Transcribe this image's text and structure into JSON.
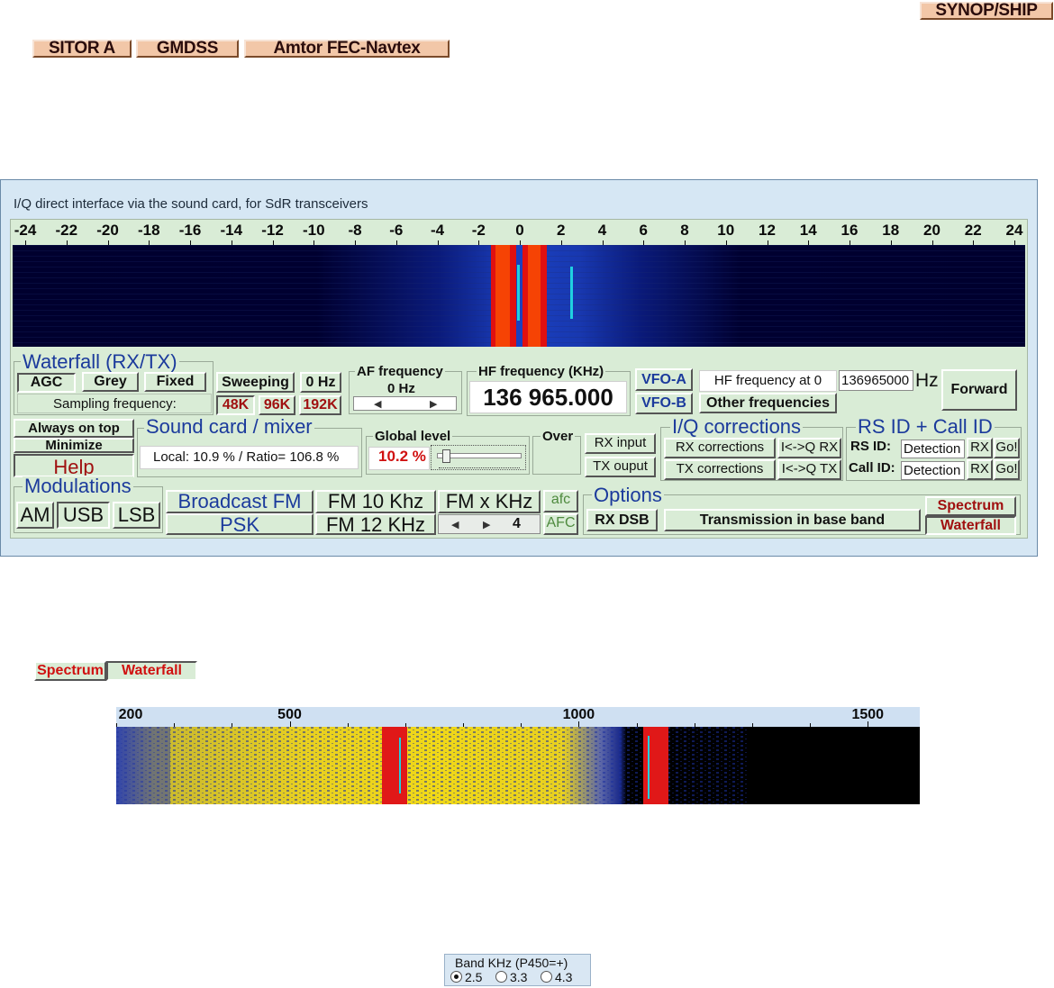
{
  "top_buttons": {
    "synop_ship": "SYNOP/SHIP",
    "sitor_a": "SITOR A",
    "gmdss": "GMDSS",
    "amtor": "Amtor FEC-Navtex"
  },
  "window": {
    "title": "I/Q direct interface via the sound card, for SdR transceivers",
    "scale_ticks": [
      "-24",
      "-22",
      "-20",
      "-18",
      "-16",
      "-14",
      "-12",
      "-10",
      "-8",
      "-6",
      "-4",
      "-2",
      "0",
      "2",
      "4",
      "6",
      "8",
      "10",
      "12",
      "14",
      "16",
      "18",
      "20",
      "22",
      "24"
    ],
    "waterfall_group": {
      "title": "Waterfall (RX/TX)",
      "agc": "AGC",
      "grey": "Grey",
      "fixed": "Fixed",
      "sweeping": "Sweeping",
      "zero_hz": "0 Hz",
      "sampling_label": "Sampling frequency:",
      "rate_48k": "48K",
      "rate_96k": "96K",
      "rate_192k": "192K"
    },
    "af_frequency": {
      "title": "AF frequency",
      "value": "0 Hz",
      "left_arrow": "◀",
      "right_arrow": "▶"
    },
    "hf_frequency": {
      "title": "HF frequency (KHz)",
      "value": "136 965.000"
    },
    "vfo_a": "VFO-A",
    "vfo_b": "VFO-B",
    "hf_at_zero_label": "HF frequency at 0",
    "hf_at_zero_value": "136965000",
    "hz_unit": "Hz",
    "other_frequencies": "Other frequencies",
    "forward": "Forward",
    "always_on_top": "Always on top",
    "minimize": "Minimize",
    "help": "Help",
    "sound_card": {
      "title": "Sound card / mixer",
      "status": "Local:  10.9 % / Ratio= 106.8 %"
    },
    "global_level": {
      "title": "Global level",
      "value": "10.2 %",
      "level": 0.102
    },
    "over": "Over",
    "rx_input": "RX input",
    "tx_ouput": "TX ouput",
    "iq_corrections": {
      "title": "I/Q corrections",
      "rx_corrections": "RX corrections",
      "tx_corrections": "TX corrections",
      "iq_rx": "I<->Q RX",
      "iq_tx": "I<->Q TX"
    },
    "rs_id": {
      "title": "RS ID + Call ID",
      "rs_id_label": "RS ID:",
      "call_id_label": "Call ID:",
      "detection": "Detection",
      "rx": "RX",
      "go": "Go!"
    },
    "modulations": {
      "title": "Modulations",
      "am": "AM",
      "usb": "USB",
      "lsb": "LSB",
      "broadcast_fm": "Broadcast FM",
      "psk": "PSK",
      "fm_10": "FM 10 Khz",
      "fm_12": "FM 12 KHz",
      "fm_x": "FM x KHz",
      "afc_lower": "afc",
      "afc_upper": "AFC",
      "stepper_value": "4"
    },
    "options": {
      "title": "Options",
      "rx_dsb": "RX DSB",
      "transmission": "Transmission in base band",
      "spectrum": "Spectrum",
      "waterfall": "Waterfall"
    }
  },
  "figure2": {
    "spectrum": "Spectrum",
    "waterfall": "Waterfall",
    "scale_ticks": [
      "200",
      "500",
      "1000",
      "1500"
    ]
  },
  "band_box": {
    "title": "Band KHz (P450=+)",
    "options": [
      "2.5",
      "3.3",
      "4.3"
    ],
    "selected": "2.5"
  },
  "colors": {
    "panel_green": "#d9ecd6",
    "title_blue": "#1b3a9c",
    "accent_red": "#a01010",
    "tab_orange": "#f2c7a8",
    "window_bg": "#d6e7f4"
  }
}
